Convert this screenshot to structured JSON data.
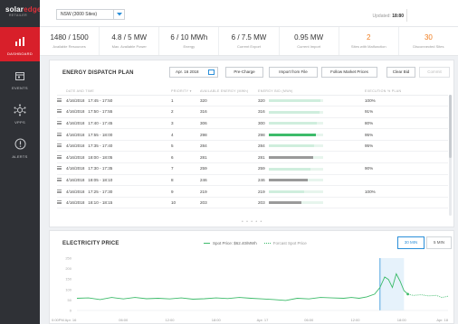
{
  "sidebar": {
    "logo_main": "solar",
    "logo_accent": "edge",
    "logo_sub": "RETAILER",
    "items": [
      {
        "label": "DASHBOARD",
        "icon": "bar-chart-icon",
        "active": true
      },
      {
        "label": "EVENTS",
        "icon": "calendar-icon",
        "active": false
      },
      {
        "label": "VPPS",
        "icon": "network-icon",
        "active": false
      },
      {
        "label": "ALERTS",
        "icon": "alert-icon",
        "active": false
      }
    ]
  },
  "topbar": {
    "site_select": "NSW (3000 Sites)",
    "updated_label": "Updated:",
    "updated_time": "18:80"
  },
  "kpis": [
    {
      "value": "1480 / 1500",
      "label": "Available Resources",
      "color": "#333333"
    },
    {
      "value": "4.8 / 5 MW",
      "label": "Max. Available Power",
      "color": "#333333"
    },
    {
      "value": "6 / 10 MWh",
      "label": "Energy",
      "color": "#333333"
    },
    {
      "value": "6 / 7.5 MW",
      "label": "Current Export",
      "color": "#333333"
    },
    {
      "value": "0.95 MW",
      "label": "Current Import",
      "color": "#333333"
    },
    {
      "value": "2",
      "label": "Sites with Malfunction",
      "color": "#f07d1e"
    },
    {
      "value": "30",
      "label": "Disconnected Sites",
      "color": "#f07d1e"
    }
  ],
  "dispatch": {
    "title": "ENERGY DISPATCH PLAN",
    "date": "Apr. 16 2018",
    "buttons": {
      "pre_charge": "Pre-Charge",
      "import_file": "Import from File",
      "follow_prices": "Follow Market Prices",
      "clear_bid": "Clear Bid",
      "commit": "Commit"
    },
    "columns": [
      "DATE AND TIME",
      "PRIORITY",
      "AVAILABLE ENERGY (MWh)",
      "ENERGY BID (MWh)",
      "EXECUTION % PLAN"
    ],
    "rows": [
      {
        "date": "4/16/2018",
        "time": "17:45 - 17:50",
        "priority": "1",
        "available": "320",
        "bid": "320",
        "bid_frac": 0.95,
        "bar_color": "#cfeedd",
        "pct": "100%"
      },
      {
        "date": "4/16/2018",
        "time": "17:50 - 17:55",
        "priority": "2",
        "available": "316",
        "bid": "316",
        "bid_frac": 0.94,
        "bar_color": "#cfeedd",
        "pct": "91%"
      },
      {
        "date": "4/16/2018",
        "time": "17:40 - 17:45",
        "priority": "3",
        "available": "306",
        "bid": "300",
        "bid_frac": 0.89,
        "bar_color": "#cfeedd",
        "pct": "80%"
      },
      {
        "date": "4/16/2018",
        "time": "17:55 - 18:00",
        "priority": "4",
        "available": "298",
        "bid": "298",
        "bid_frac": 0.88,
        "bar_color": "#3dbb6a",
        "pct": "95%"
      },
      {
        "date": "4/16/2018",
        "time": "17:35 - 17:40",
        "priority": "5",
        "available": "284",
        "bid": "284",
        "bid_frac": 0.84,
        "bar_color": "#cfeedd",
        "pct": "95%"
      },
      {
        "date": "4/16/2018",
        "time": "18:00 - 18:05",
        "priority": "6",
        "available": "281",
        "bid": "281",
        "bid_frac": 0.83,
        "bar_color": "#9a9a9a",
        "pct": ""
      },
      {
        "date": "4/16/2018",
        "time": "17:30 - 17:35",
        "priority": "7",
        "available": "259",
        "bid": "259",
        "bid_frac": 0.77,
        "bar_color": "#cfeedd",
        "pct": "90%"
      },
      {
        "date": "4/16/2018",
        "time": "18:05 - 18:10",
        "priority": "8",
        "available": "246",
        "bid": "246",
        "bid_frac": 0.73,
        "bar_color": "#9a9a9a",
        "pct": ""
      },
      {
        "date": "4/16/2018",
        "time": "17:25 - 17:30",
        "priority": "9",
        "available": "219",
        "bid": "219",
        "bid_frac": 0.65,
        "bar_color": "#cfeedd",
        "pct": "100%"
      },
      {
        "date": "4/16/2018",
        "time": "18:10 - 18:15",
        "priority": "10",
        "available": "203",
        "bid": "203",
        "bid_frac": 0.6,
        "bar_color": "#9a9a9a",
        "pct": ""
      }
    ]
  },
  "price": {
    "title": "ELECTRICITY PRICE",
    "legend_spot_label": "Spot Price:",
    "legend_spot_value": "$62.40/MWh",
    "legend_forecast": "Forcast Spot Price",
    "toggle_30": "30 MIN",
    "toggle_5": "5 MIN",
    "series_color": "#3dbb6a"
  },
  "chart_data": {
    "type": "line",
    "title": "ELECTRICITY PRICE",
    "ylim": [
      0,
      250
    ],
    "yticks": [
      "250",
      "200",
      "150",
      "100",
      "50",
      "0"
    ],
    "xticks": [
      "0:00PM  Apr. 16",
      "06:00",
      "12:00",
      "18:00",
      "Apr. 17",
      "06:00",
      "12:00",
      "18:00",
      "Apr. 18"
    ],
    "xlim": [
      0,
      48
    ],
    "series": [
      {
        "name": "Spot Price",
        "style": "solid",
        "points": [
          [
            0,
            58
          ],
          [
            1.5,
            60
          ],
          [
            3,
            52
          ],
          [
            4.5,
            62
          ],
          [
            6,
            55
          ],
          [
            7.5,
            62
          ],
          [
            9,
            56
          ],
          [
            10.5,
            58
          ],
          [
            12,
            55
          ],
          [
            13.5,
            60
          ],
          [
            15,
            54
          ],
          [
            16.5,
            56
          ],
          [
            18,
            60
          ],
          [
            19.5,
            57
          ],
          [
            21,
            62
          ],
          [
            22.5,
            58
          ],
          [
            24,
            55
          ],
          [
            25.5,
            52
          ],
          [
            27,
            48
          ],
          [
            28.5,
            58
          ],
          [
            30,
            55
          ],
          [
            31.5,
            62
          ],
          [
            33,
            60
          ],
          [
            34.5,
            58
          ],
          [
            35.5,
            62
          ],
          [
            36.5,
            58
          ],
          [
            37.5,
            65
          ],
          [
            38.5,
            78
          ],
          [
            39.2,
            110
          ],
          [
            39.8,
            160
          ],
          [
            40.3,
            148
          ],
          [
            40.8,
            110
          ],
          [
            41.3,
            175
          ],
          [
            41.8,
            140
          ],
          [
            42.3,
            95
          ],
          [
            42.8,
            78
          ]
        ]
      },
      {
        "name": "Forcast Spot Price",
        "style": "dotted",
        "points": [
          [
            42.8,
            78
          ],
          [
            43.5,
            72
          ],
          [
            44.5,
            75
          ],
          [
            45.5,
            70
          ],
          [
            46.5,
            72
          ],
          [
            47.2,
            62
          ],
          [
            48,
            68
          ]
        ]
      }
    ],
    "highlight_band": [
      39.2,
      42.3
    ],
    "grid": false
  }
}
